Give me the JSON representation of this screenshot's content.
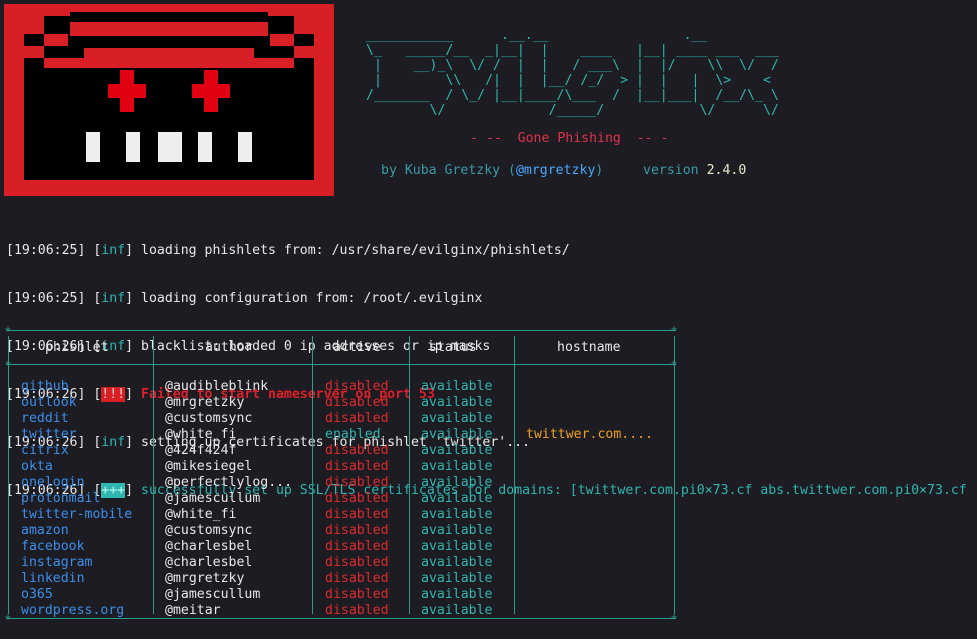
{
  "banner": {
    "ascii_art": "___________      .__.__                 .__\n\\_   _____/__  _|__|  |    ____   |__| ____ ___  ___\n |    __)_\\  \\/ /  |  |   / ___\\  |  |/    \\\\  \\/  /\n |        \\\\   /|  |  |__/ /_/  > |  |   |  \\>    <\n/_______  / \\_/ |__|____/\\___  /  |__|___|  /__/\\_ \\\n        \\/             /_____/            \\/      \\/",
    "tagline": "- --  Gone Phishing  -- -",
    "by_prefix": "by Kuba Gretzky (",
    "handle": "@mrgretzky",
    "by_suffix": ")",
    "version_label": "version",
    "version": "2.4.0"
  },
  "log": [
    {
      "time": "[19:06:25]",
      "level": "inf",
      "message": "loading phishlets from: /usr/share/evilginx/phishlets/"
    },
    {
      "time": "[19:06:25]",
      "level": "inf",
      "message": "loading configuration from: /root/.evilginx"
    },
    {
      "time": "[19:06:26]",
      "level": "inf",
      "message": "blacklist: loaded 0 ip addresses or ip masks"
    },
    {
      "time": "[19:06:26]",
      "level": "!!!",
      "message": "Failed to start nameserver on port 53"
    },
    {
      "time": "[19:06:26]",
      "level": "inf",
      "message": "setting up certificates for phishlet 'twitter'..."
    },
    {
      "time": "[19:06:26]",
      "level": "+++",
      "message": "successfully set up SSL/TLS certificates for domains: [twittwer.com.pi0×73.cf abs.twittwer.com.pi0×73.cf"
    }
  ],
  "table": {
    "headers": [
      "phishlet",
      "author",
      "active",
      "status",
      "hostname"
    ],
    "rows": [
      {
        "phishlet": "github",
        "author": "@audibleblink",
        "active": "disabled",
        "status": "available",
        "hostname": ""
      },
      {
        "phishlet": "outlook",
        "author": "@mrgretzky",
        "active": "disabled",
        "status": "available",
        "hostname": ""
      },
      {
        "phishlet": "reddit",
        "author": "@customsync",
        "active": "disabled",
        "status": "available",
        "hostname": ""
      },
      {
        "phishlet": "twitter",
        "author": "@white_fi",
        "active": "enabled",
        "status": "available",
        "hostname": "twittwer.com...."
      },
      {
        "phishlet": "citrix",
        "author": "@424f424f",
        "active": "disabled",
        "status": "available",
        "hostname": ""
      },
      {
        "phishlet": "okta",
        "author": "@mikesiegel",
        "active": "disabled",
        "status": "available",
        "hostname": ""
      },
      {
        "phishlet": "onelogin",
        "author": "@perfectlylog...",
        "active": "disabled",
        "status": "available",
        "hostname": ""
      },
      {
        "phishlet": "protonmail",
        "author": "@jamescullum",
        "active": "disabled",
        "status": "available",
        "hostname": ""
      },
      {
        "phishlet": "twitter-mobile",
        "author": "@white_fi",
        "active": "disabled",
        "status": "available",
        "hostname": ""
      },
      {
        "phishlet": "amazon",
        "author": "@customsync",
        "active": "disabled",
        "status": "available",
        "hostname": ""
      },
      {
        "phishlet": "facebook",
        "author": "@charlesbel",
        "active": "disabled",
        "status": "available",
        "hostname": ""
      },
      {
        "phishlet": "instagram",
        "author": "@charlesbel",
        "active": "disabled",
        "status": "available",
        "hostname": ""
      },
      {
        "phishlet": "linkedin",
        "author": "@mrgretzky",
        "active": "disabled",
        "status": "available",
        "hostname": ""
      },
      {
        "phishlet": "o365",
        "author": "@jamescullum",
        "active": "disabled",
        "status": "available",
        "hostname": ""
      },
      {
        "phishlet": "wordpress.org",
        "author": "@meitar",
        "active": "disabled",
        "status": "available",
        "hostname": ""
      }
    ]
  },
  "colors": {
    "background": "#1c1c22",
    "accent": "#2fb6b0",
    "error": "#e0282f",
    "logo_red": "#d81f26",
    "link_blue": "#3b8fea",
    "hostname_orange": "#f0a020"
  }
}
